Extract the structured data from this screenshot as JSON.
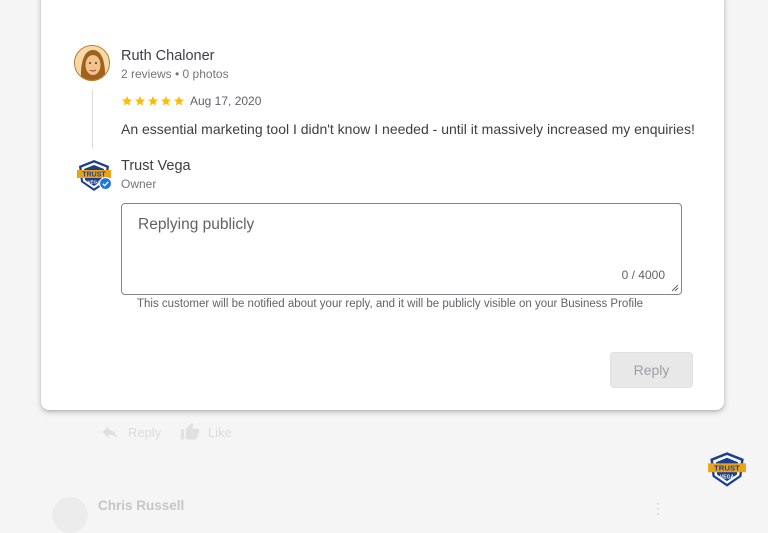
{
  "review": {
    "author_name": "Ruth Chaloner",
    "author_meta": "2 reviews • 0 photos",
    "rating": 5,
    "date": "Aug 17, 2020",
    "text": "An essential marketing tool I didn't know I needed - until it massively increased my enquiries!"
  },
  "owner": {
    "name": "Trust Vega",
    "role": "Owner",
    "logo_text_top": "TRUST",
    "logo_text_bottom": "VEGA"
  },
  "reply_form": {
    "placeholder": "Replying publicly",
    "char_count": "0 / 4000",
    "notice": "This customer will be notified about your reply, and it will be publicly visible on your Business Profile",
    "submit_label": "Reply"
  },
  "review_actions": {
    "reply_label": "Reply",
    "like_label": "Like"
  },
  "next_review": {
    "author_name": "Chris Russell"
  },
  "colors": {
    "star": "#fbbc04",
    "verified": "#1a73e8",
    "logo_navy": "#1d3f8f",
    "logo_gold": "#e8a317"
  },
  "icons": {
    "reply": "reply-arrow-icon",
    "like": "thumbs-up-icon",
    "verified": "verified-check-icon",
    "more": "more-vert-icon"
  }
}
